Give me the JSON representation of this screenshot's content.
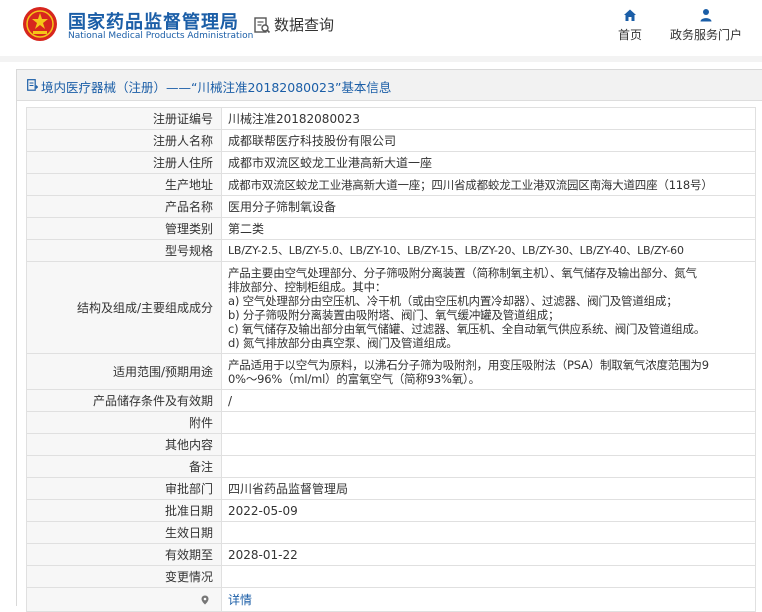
{
  "header": {
    "site_name_cn": "国家药品监督管理局",
    "site_name_en": "National Medical Products Administration",
    "query_title": "数据查询",
    "nav": [
      {
        "label": "首页",
        "icon": "home-icon"
      },
      {
        "label": "政务服务门户",
        "icon": "user-icon"
      }
    ]
  },
  "title_bar": {
    "text": "境内医疗器械（注册）——“川械注准20182080023”基本信息"
  },
  "rows": [
    {
      "label": "注册证编号",
      "value": "川械注准20182080023"
    },
    {
      "label": "注册人名称",
      "value": "成都联帮医疗科技股份有限公司"
    },
    {
      "label": "注册人住所",
      "value": "成都市双流区蛟龙工业港高新大道一座"
    },
    {
      "label": "生产地址",
      "value": "成都市双流区蛟龙工业港高新大道一座；四川省成都蛟龙工业港双流园区南海大道四座（118号）"
    },
    {
      "label": "产品名称",
      "value": "医用分子筛制氧设备"
    },
    {
      "label": "管理类别",
      "value": "第二类"
    },
    {
      "label": "型号规格",
      "value": "LB/ZY-2.5、LB/ZY-5.0、LB/ZY-10、LB/ZY-15、LB/ZY-20、LB/ZY-30、LB/ZY-40、LB/ZY-60"
    },
    {
      "label": "结构及组成/主要组成成分",
      "value": "产品主要由空气处理部分、分子筛吸附分离装置（简称制氧主机）、氧气储存及输出部分、氮气\n排放部分、控制柜组成。其中：\na) 空气处理部分由空压机、冷干机（或由空压机内置冷却器）、过滤器、阀门及管道组成；\nb) 分子筛吸附分离装置由吸附塔、阀门、氧气缓冲罐及管道组成；\nc) 氧气储存及输出部分由氧气储罐、过滤器、氧压机、全自动氧气供应系统、阀门及管道组成。\nd) 氮气排放部分由真空泵、阀门及管道组成。"
    },
    {
      "label": "适用范围/预期用途",
      "value": "产品适用于以空气为原料，以沸石分子筛为吸附剂，用变压吸附法（PSA）制取氧气浓度范围为9\n0%～96%（ml/ml）的富氧空气（简称93%氧）。"
    },
    {
      "label": "产品储存条件及有效期",
      "value": "/"
    },
    {
      "label": "附件",
      "value": ""
    },
    {
      "label": "其他内容",
      "value": ""
    },
    {
      "label": "备注",
      "value": ""
    },
    {
      "label": "审批部门",
      "value": "四川省药品监督管理局"
    },
    {
      "label": "批准日期",
      "value": "2022-05-09"
    },
    {
      "label": "生效日期",
      "value": ""
    },
    {
      "label": "有效期至",
      "value": "2028-01-22"
    },
    {
      "label": "变更情况",
      "value": ""
    },
    {
      "label": "",
      "value": "详情"
    }
  ],
  "colors": {
    "brand_blue": "#1b5ea7",
    "label_bg": "#f7f7f7",
    "border": "#e0e0e0"
  }
}
